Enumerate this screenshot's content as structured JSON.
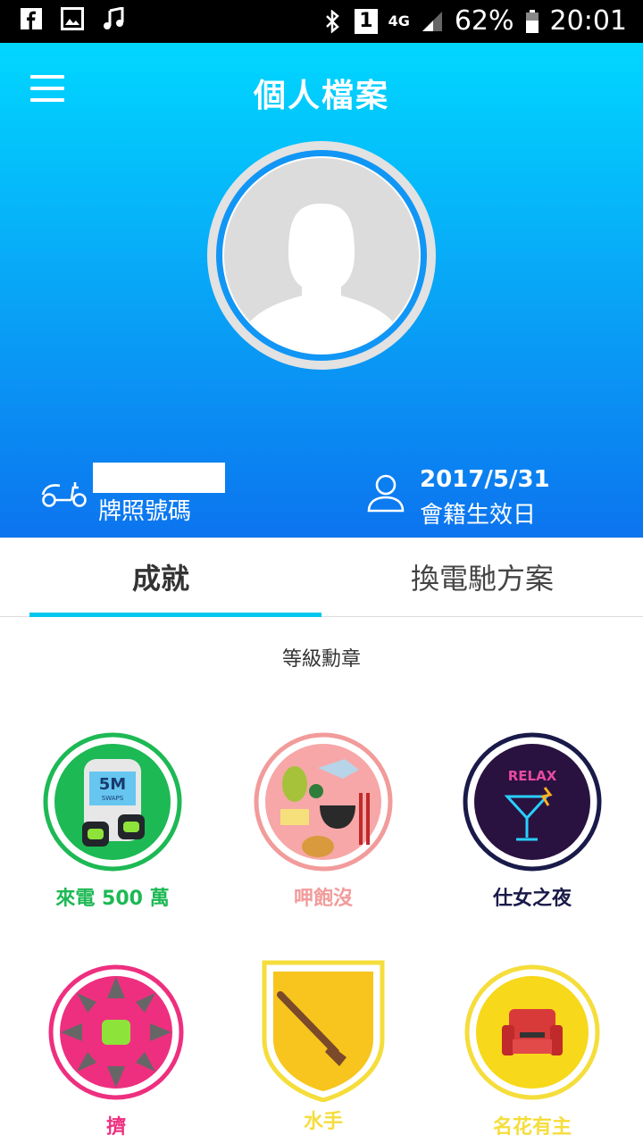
{
  "status_bar": {
    "battery": "62%",
    "time": "20:01",
    "network": "4G",
    "sim": "1"
  },
  "header": {
    "title": "個人檔案"
  },
  "profile": {
    "plate_label": "牌照號碼",
    "membership_date": "2017/5/31",
    "membership_label": "會籍生效日"
  },
  "tabs": [
    {
      "label": "成就",
      "active": true
    },
    {
      "label": "換電馳方案",
      "active": false
    }
  ],
  "section": {
    "title": "等級勳章"
  },
  "badges": [
    {
      "label": "來電 500 萬",
      "color": "#1db954",
      "inner_text": "5M",
      "inner_sub": "SWAPS"
    },
    {
      "label": "呷飽沒",
      "color": "#f29b9b"
    },
    {
      "label": "仕女之夜",
      "color": "#1a1a4a",
      "inner_text": "RELAX"
    },
    {
      "label": "擠",
      "color": "#ee2f7f"
    },
    {
      "label": "水手",
      "color": "#f5dd3b"
    },
    {
      "label": "名花有主",
      "color": "#f5dd3b"
    }
  ],
  "colors": {
    "header_top": "#00d7ff",
    "header_bottom": "#0c74ef",
    "tab_accent": "#00c8f0"
  }
}
